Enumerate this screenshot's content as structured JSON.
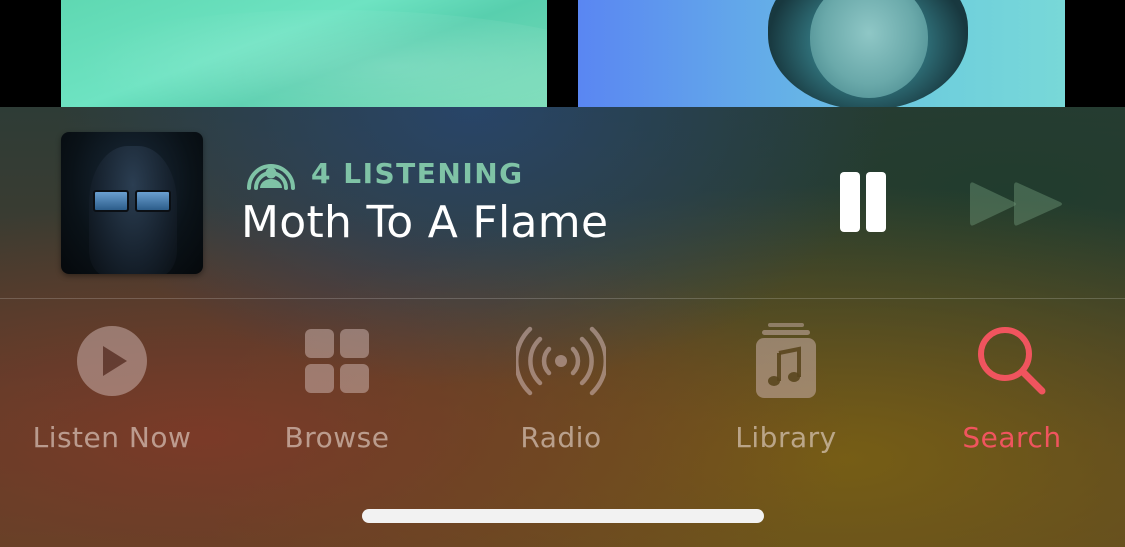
{
  "now_playing": {
    "listening_text": "4 LISTENING",
    "song_title": "Moth To A Flame",
    "state_icon": "pause-icon",
    "next_icon": "fast-forward-icon"
  },
  "tabs": [
    {
      "label": "Listen Now",
      "icon": "play-circle-icon",
      "active": false
    },
    {
      "label": "Browse",
      "icon": "grid-icon",
      "active": false
    },
    {
      "label": "Radio",
      "icon": "broadcast-icon",
      "active": false
    },
    {
      "label": "Library",
      "icon": "music-library-icon",
      "active": false
    },
    {
      "label": "Search",
      "icon": "search-icon",
      "active": true
    }
  ],
  "colors": {
    "accent": "#f0545e",
    "listening": "#7fc3a6",
    "inactive_tab": "#bfaea6"
  }
}
